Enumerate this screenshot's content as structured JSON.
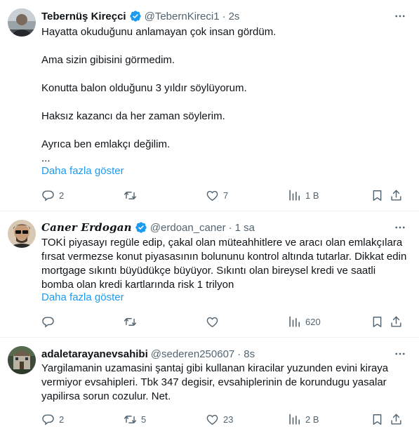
{
  "colors": {
    "link": "#1d9bf0",
    "muted": "#536471",
    "text": "#0f1419",
    "verified": "#1d9bf0",
    "divider": "#eff3f4"
  },
  "tweets": [
    {
      "name": "Tebernüş Kireçci",
      "handle": "@TebernKireci1",
      "dot": "·",
      "time": "2s",
      "paragraphs": [
        "Hayatta okuduğunu anlamayan çok insan gördüm.",
        "Ama sizin gibisini görmedim.",
        "Konutta balon olduğunu 3 yıldır söylüyorum.",
        "Haksız kazancı da her zaman söylerim.",
        "Ayrıca ben emlakçı değilim.",
        "..."
      ],
      "show_more": "Daha fazla göster",
      "stats": {
        "replies": "2",
        "retweets": "",
        "likes": "7",
        "views": "1 B"
      }
    },
    {
      "name": "Caner Erdogan",
      "handle": "@erdoan_caner",
      "dot": "·",
      "time": "1 sa",
      "text": "TOKİ piyasayı regüle edip, çakal olan müteahhitlere ve aracı olan emlakçılara fırsat vermezse konut piyasasının bolununu kontrol altında tutarlar. Dikkat edin mortgage sıkıntı büyüdükçe büyüyor. Sıkıntı olan bireysel kredi ve saatli bomba olan kredi kartlarında risk 1 trilyon",
      "show_more": "Daha fazla göster",
      "stats": {
        "replies": "",
        "retweets": "",
        "likes": "",
        "views": "620"
      }
    },
    {
      "name": "adaletarayanevsahibi",
      "handle": "@sederen250607",
      "dot": "·",
      "time": "8s",
      "text": "Yargilamanin uzamasini şantaj gibi kullanan kiracilar yuzunden evini kiraya vermiyor evsahipleri.  Tbk 347 degisir, evsahiplerinin de korundugu yasalar yapilirsa sorun cozulur. Net.",
      "stats": {
        "replies": "2",
        "retweets": "5",
        "likes": "23",
        "views": "2 B"
      }
    }
  ],
  "icons": [
    "verified-icon",
    "more-icon",
    "reply-icon",
    "retweet-icon",
    "like-icon",
    "views-icon",
    "bookmark-icon",
    "share-icon"
  ]
}
